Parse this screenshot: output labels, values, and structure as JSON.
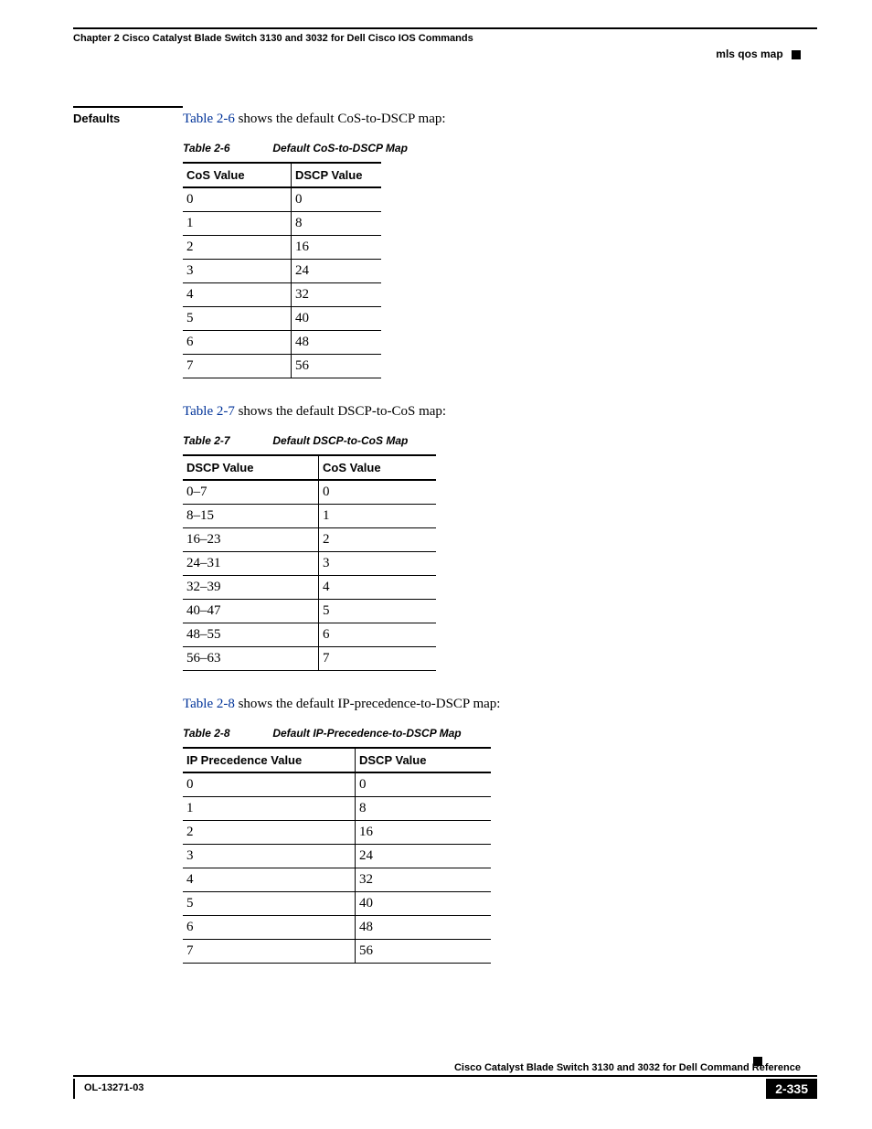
{
  "header": {
    "chapter": "Chapter 2      Cisco Catalyst Blade Switch 3130 and 3032 for Dell Cisco IOS Commands",
    "topic": "mls qos map"
  },
  "sidelabel": "Defaults",
  "intro1": {
    "ref": "Table 2-6",
    "rest": " shows the default CoS-to-DSCP map:"
  },
  "table1": {
    "capnum": "Table 2-6",
    "captitle": "Default CoS-to-DSCP Map",
    "h1": "CoS Value",
    "h2": "DSCP Value",
    "rows": [
      {
        "a": "0",
        "b": "0"
      },
      {
        "a": "1",
        "b": "8"
      },
      {
        "a": "2",
        "b": "16"
      },
      {
        "a": "3",
        "b": "24"
      },
      {
        "a": "4",
        "b": "32"
      },
      {
        "a": "5",
        "b": "40"
      },
      {
        "a": "6",
        "b": "48"
      },
      {
        "a": "7",
        "b": "56"
      }
    ]
  },
  "intro2": {
    "ref": "Table 2-7",
    "rest": " shows the default DSCP-to-CoS map:"
  },
  "table2": {
    "capnum": "Table 2-7",
    "captitle": "Default DSCP-to-CoS Map",
    "h1": "DSCP Value",
    "h2": "CoS Value",
    "rows": [
      {
        "a": "0–7",
        "b": "0"
      },
      {
        "a": "8–15",
        "b": "1"
      },
      {
        "a": "16–23",
        "b": "2"
      },
      {
        "a": "24–31",
        "b": "3"
      },
      {
        "a": "32–39",
        "b": "4"
      },
      {
        "a": "40–47",
        "b": "5"
      },
      {
        "a": "48–55",
        "b": "6"
      },
      {
        "a": "56–63",
        "b": "7"
      }
    ]
  },
  "intro3": {
    "ref": "Table 2-8",
    "rest": " shows the default IP-precedence-to-DSCP map:"
  },
  "table3": {
    "capnum": "Table 2-8",
    "captitle": "Default IP-Precedence-to-DSCP Map",
    "h1": "IP Precedence Value",
    "h2": "DSCP Value",
    "rows": [
      {
        "a": "0",
        "b": "0"
      },
      {
        "a": "1",
        "b": "8"
      },
      {
        "a": "2",
        "b": "16"
      },
      {
        "a": "3",
        "b": "24"
      },
      {
        "a": "4",
        "b": "32"
      },
      {
        "a": "5",
        "b": "40"
      },
      {
        "a": "6",
        "b": "48"
      },
      {
        "a": "7",
        "b": "56"
      }
    ]
  },
  "footer": {
    "title": "Cisco Catalyst Blade Switch 3130 and 3032 for Dell Command Reference",
    "docid": "OL-13271-03",
    "page": "2-335"
  }
}
